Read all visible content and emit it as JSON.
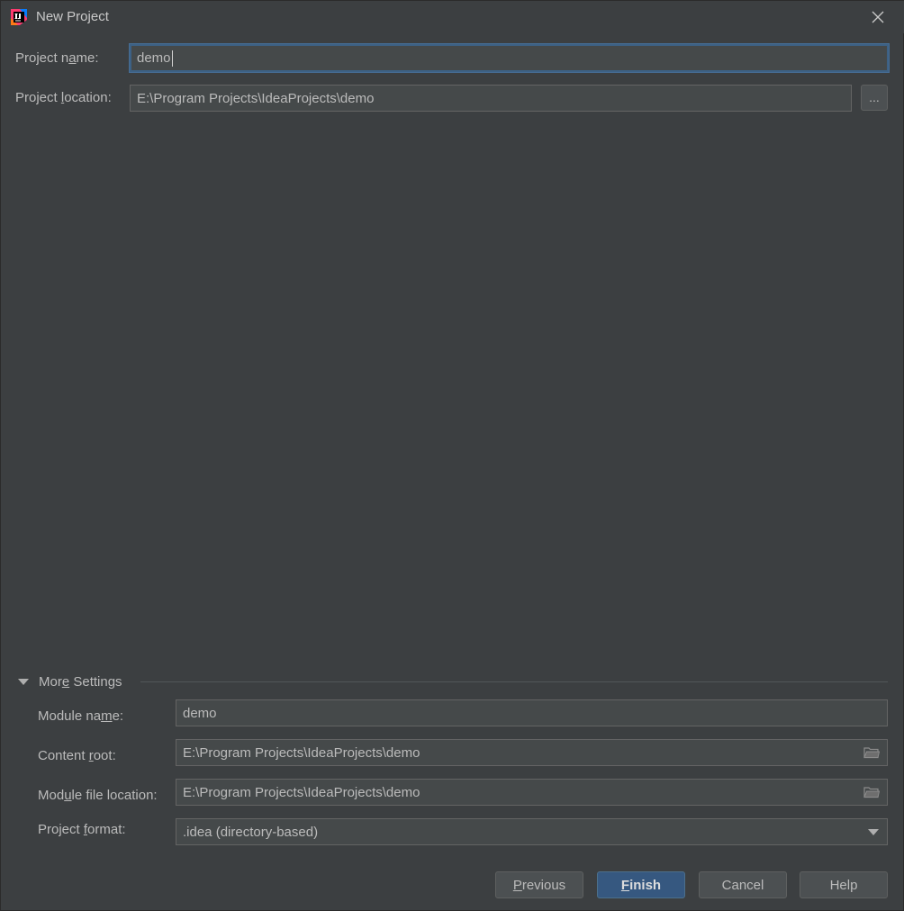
{
  "window": {
    "title": "New Project",
    "icon": "intellij-idea-icon",
    "close_icon": "close-icon"
  },
  "project": {
    "name_label_pre": "Project n",
    "name_label_mnemonic": "a",
    "name_label_post": "me:",
    "name_value": "demo",
    "location_label_pre": "Project ",
    "location_label_mnemonic": "l",
    "location_label_post": "ocation:",
    "location_value": "E:\\Program Projects\\IdeaProjects\\demo",
    "browse_label": "..."
  },
  "more_settings": {
    "toggle_label_pre": "Mor",
    "toggle_label_mnemonic": "e",
    "toggle_label_post": " Settings",
    "expanded": true,
    "module_name_label_pre": "Module na",
    "module_name_label_mnemonic": "m",
    "module_name_label_post": "e:",
    "module_name_value": "demo",
    "content_root_label_pre": "Content ",
    "content_root_label_mnemonic": "r",
    "content_root_label_post": "oot:",
    "content_root_value": "E:\\Program Projects\\IdeaProjects\\demo",
    "module_file_label_pre": "Mod",
    "module_file_label_mnemonic": "u",
    "module_file_label_post": "le file location:",
    "module_file_value": "E:\\Program Projects\\IdeaProjects\\demo",
    "project_format_label_pre": "Project ",
    "project_format_label_mnemonic": "f",
    "project_format_label_post": "ormat:",
    "project_format_value": ".idea (directory-based)"
  },
  "buttons": {
    "previous_mnemonic": "P",
    "previous_rest": "revious",
    "finish_mnemonic": "F",
    "finish_rest": "inish",
    "cancel": "Cancel",
    "help": "Help"
  },
  "colors": {
    "background": "#3c3f41",
    "field_background": "#45494a",
    "focus_border": "#3d6185",
    "primary_button": "#365880"
  }
}
